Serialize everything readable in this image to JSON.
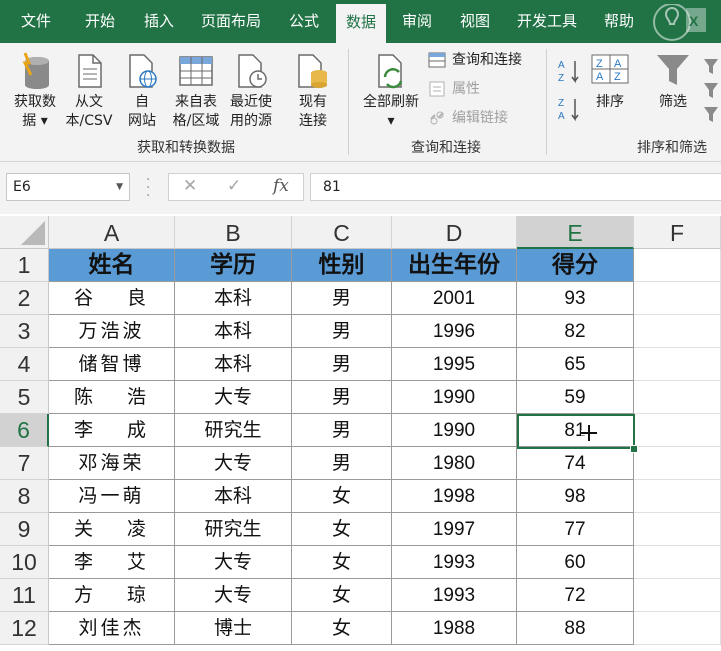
{
  "tabs": [
    "文件",
    "开始",
    "插入",
    "页面布局",
    "公式",
    "数据",
    "审阅",
    "视图",
    "开发工具",
    "帮助"
  ],
  "active_tab": "数据",
  "logo_icon": "excel-logo-icon",
  "ribbon": {
    "get_data": {
      "line1": "获取数",
      "line2": "据 ▾"
    },
    "from_csv": {
      "line1": "从文",
      "line2": "本/CSV"
    },
    "from_web": {
      "line1": "自",
      "line2": "网站"
    },
    "from_table": {
      "line1": "来自表",
      "line2": "格/区域"
    },
    "recent_sources": {
      "line1": "最近使",
      "line2": "用的源"
    },
    "existing_conn": {
      "line1": "现有",
      "line2": "连接"
    },
    "refresh_all": {
      "line1": "全部刷新",
      "line2": "▾"
    },
    "queries_connections": "查询和连接",
    "properties": "属性",
    "edit_links": "编辑链接",
    "sort": "排序",
    "filter": "筛选",
    "group1_label": "获取和转换数据",
    "group2_label": "查询和连接",
    "group3_label": "排序和筛选"
  },
  "formula_bar": {
    "name_box": "E6",
    "cancel_icon": "✕",
    "enter_icon": "✓",
    "fx_icon": "fx",
    "value": "81"
  },
  "columns": [
    "A",
    "B",
    "C",
    "D",
    "E",
    "F"
  ],
  "selected_column": "E",
  "selected_row": "6",
  "rows": [
    {
      "num": "1",
      "cells": [
        "姓名",
        "学历",
        "性别",
        "出生年份",
        "得分"
      ]
    },
    {
      "num": "2",
      "cells": [
        "谷　 良",
        "本科",
        "男",
        "2001",
        "93"
      ]
    },
    {
      "num": "3",
      "cells": [
        "万浩波",
        "本科",
        "男",
        "1996",
        "82"
      ]
    },
    {
      "num": "4",
      "cells": [
        "储智博",
        "本科",
        "男",
        "1995",
        "65"
      ]
    },
    {
      "num": "5",
      "cells": [
        "陈　 浩",
        "大专",
        "男",
        "1990",
        "59"
      ]
    },
    {
      "num": "6",
      "cells": [
        "李　 成",
        "研究生",
        "男",
        "1990",
        "81"
      ]
    },
    {
      "num": "7",
      "cells": [
        "邓海荣",
        "大专",
        "男",
        "1980",
        "74"
      ]
    },
    {
      "num": "8",
      "cells": [
        "冯一萌",
        "本科",
        "女",
        "1998",
        "98"
      ]
    },
    {
      "num": "9",
      "cells": [
        "关　 凌",
        "研究生",
        "女",
        "1997",
        "77"
      ]
    },
    {
      "num": "10",
      "cells": [
        "李　 艾",
        "大专",
        "女",
        "1993",
        "60"
      ]
    },
    {
      "num": "11",
      "cells": [
        "方　 琼",
        "大专",
        "女",
        "1993",
        "72"
      ]
    },
    {
      "num": "12",
      "cells": [
        "刘佳杰",
        "博士",
        "女",
        "1988",
        "88"
      ]
    }
  ],
  "colors": {
    "excel_green": "#217346",
    "header_fill": "#5b9bd5",
    "ribbon_bg": "#f3f3f3"
  }
}
